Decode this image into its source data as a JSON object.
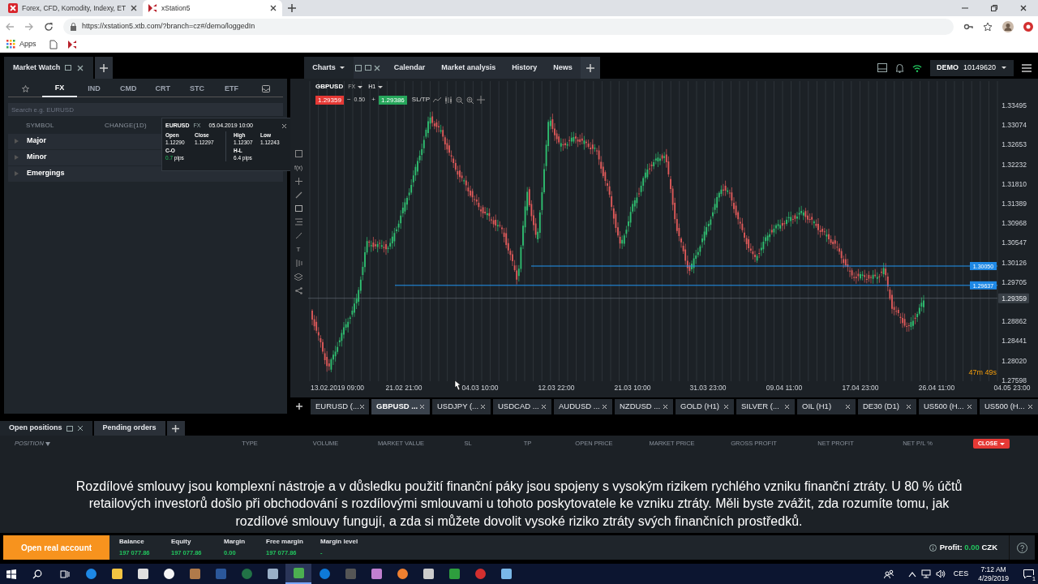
{
  "browser": {
    "tabs": [
      {
        "label": "Forex, CFD, Komodity, Indexy, ET",
        "selected": false
      },
      {
        "label": "xStation5",
        "selected": true
      }
    ],
    "url": "https://xstation5.xtb.com/?branch=cz#/demo/loggedIn",
    "bookmarks": [
      "Apps"
    ]
  },
  "top_nav": {
    "panel_tab": "Market Watch",
    "chart_tabs": [
      {
        "label": "Charts",
        "selected": true
      },
      {
        "label": "Calendar",
        "selected": false
      },
      {
        "label": "Market analysis",
        "selected": false
      },
      {
        "label": "History",
        "selected": false
      },
      {
        "label": "News",
        "selected": false
      }
    ],
    "account_type": "DEMO",
    "account_number": "10149620"
  },
  "market_watch": {
    "tabs": [
      {
        "label": "FX",
        "selected": true
      },
      {
        "label": "IND",
        "selected": false
      },
      {
        "label": "CMD",
        "selected": false
      },
      {
        "label": "CRT",
        "selected": false
      },
      {
        "label": "STC",
        "selected": false
      },
      {
        "label": "ETF",
        "selected": false
      }
    ],
    "search": {
      "placeholder": "Search e.g. EURUSD"
    },
    "columns": [
      "SYMBOL",
      "CHANGE(1D)"
    ],
    "groups": [
      {
        "name": "Major",
        "expanded": false
      },
      {
        "name": "Minor",
        "expanded": false
      },
      {
        "name": "Emergings",
        "expanded": false
      }
    ],
    "tooltip": {
      "symbol": "EURUSD",
      "market": "FX",
      "date": "05.04.2019 10:00",
      "cells": [
        {
          "label": "Open",
          "value": "1.12290"
        },
        {
          "label": "Close",
          "value": "1.12297"
        },
        {
          "label": "High",
          "value": "1.12307"
        },
        {
          "label": "Low",
          "value": "1.12243"
        }
      ],
      "co_label": "C-O",
      "co_value": "0.7",
      "co_unit": "pips",
      "hl_label": "H-L",
      "hl_value": "6.4 pips"
    }
  },
  "chart": {
    "symbol": "GBPUSD",
    "market": "FX",
    "interval": "H1",
    "sell_price": "1.29359",
    "minus": "−",
    "spread": "0.50",
    "plus": "+",
    "buy_price": "1.29386",
    "sltp": "SL/TP",
    "fx_tool": "f(x)",
    "text_tool": "T",
    "y_axis_labels": [
      "1.33495",
      "1.33074",
      "1.32653",
      "1.32232",
      "1.31810",
      "1.31389",
      "1.30968",
      "1.30547",
      "1.30126",
      "1.29705",
      "1.28862",
      "1.28441",
      "1.28020",
      "1.27598"
    ],
    "x_axis_labels": [
      "13.02.2019 09:00",
      "21.02 21:00",
      "04.03 10:00",
      "12.03 22:00",
      "21.03 10:00",
      "31.03 23:00",
      "09.04 11:00",
      "17.04 23:00",
      "26.04 11:00",
      "04.05 23:00"
    ],
    "lines": [
      {
        "price": "1.30050"
      },
      {
        "price": "1.29637"
      }
    ],
    "current_price": "1.29359",
    "countdown": "47m 49s"
  },
  "chart_tabs": [
    {
      "label": "EURUSD (...",
      "selected": false
    },
    {
      "label": "GBPUSD ...",
      "selected": true
    },
    {
      "label": "USDJPY (...",
      "selected": false
    },
    {
      "label": "USDCAD ...",
      "selected": false
    },
    {
      "label": "AUDUSD ...",
      "selected": false
    },
    {
      "label": "NZDUSD ...",
      "selected": false
    },
    {
      "label": "GOLD (H1)",
      "selected": false
    },
    {
      "label": "SILVER (...",
      "selected": false
    },
    {
      "label": "OIL (H1)",
      "selected": false
    },
    {
      "label": "DE30 (D1)",
      "selected": false
    },
    {
      "label": "US500 (H...",
      "selected": false
    },
    {
      "label": "US500 (H...",
      "selected": false
    }
  ],
  "positions": {
    "tabs": [
      {
        "label": "Open positions",
        "selected": true
      },
      {
        "label": "Pending orders",
        "selected": false
      }
    ],
    "columns": [
      "POSITION",
      "TYPE",
      "VOLUME",
      "MARKET VALUE",
      "SL",
      "TP",
      "OPEN PRICE",
      "MARKET PRICE",
      "GROSS PROFIT",
      "NET PROFIT",
      "NET P/L %"
    ],
    "close_button": "CLOSE"
  },
  "disclaimer": "Rozdílové smlouvy jsou komplexní nástroje a v důsledku použití finanční páky jsou spojeny s vysokým rizikem rychlého vzniku finanční ztráty. U 80 % účtů retailových investorů došlo při obchodování s rozdílovými smlouvami u tohoto poskytovatele ke vzniku ztráty. Měli byste zvážit, zda rozumíte tomu, jak rozdílové smlouvy fungují, a zda si můžete dovolit vysoké riziko ztráty svých finančních prostředků.",
  "footer": {
    "button": "Open real account",
    "stats": [
      {
        "label": "Balance",
        "value": "197 077.86"
      },
      {
        "label": "Equity",
        "value": "197 077.86"
      },
      {
        "label": "Margin",
        "value": "0.00"
      },
      {
        "label": "Free margin",
        "value": "197 077.86"
      },
      {
        "label": "Margin level",
        "value": "-"
      }
    ],
    "profit_label": "Profit:",
    "profit_value": "0.00",
    "currency": "CZK"
  },
  "taskbar": {
    "apps": [
      {
        "color": "#1e88e5",
        "selected": false
      },
      {
        "color": "#f4c542",
        "selected": false
      },
      {
        "color": "#e0e0e0",
        "selected": false
      },
      {
        "color": "#f5f5f5",
        "selected": false
      },
      {
        "color": "#b07a4a",
        "selected": false
      },
      {
        "color": "#2b579a",
        "selected": false
      },
      {
        "color": "#217346",
        "selected": false
      },
      {
        "color": "#9ab0c8",
        "selected": false
      },
      {
        "color": "#4caf50",
        "selected": true
      },
      {
        "color": "#0e7ad8",
        "selected": false
      },
      {
        "color": "#555555",
        "selected": false
      },
      {
        "color": "#c080d0",
        "selected": false
      },
      {
        "color": "#f08030",
        "selected": false
      },
      {
        "color": "#cccccc",
        "selected": false
      },
      {
        "color": "#2e9e3e",
        "selected": false
      },
      {
        "color": "#d32f2f",
        "selected": false
      },
      {
        "color": "#7ab8e8",
        "selected": false
      }
    ],
    "language": "CES",
    "time": "7:12 AM",
    "date": "4/29/2019",
    "notifications": "1"
  }
}
